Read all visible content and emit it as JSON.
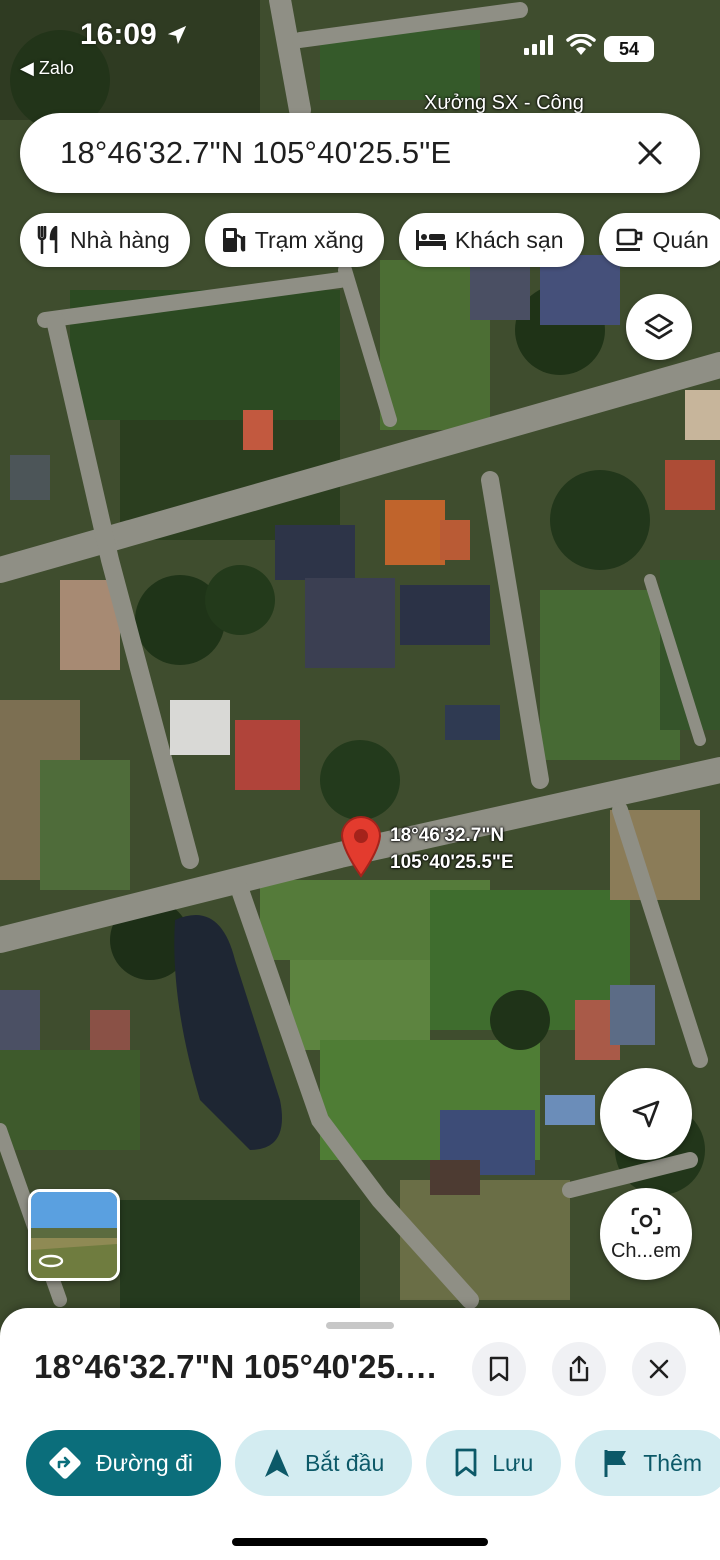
{
  "status_bar": {
    "time": "16:09",
    "back_app": "◀ Zalo",
    "battery": "54"
  },
  "map": {
    "place_label": "Xưởng SX - Công"
  },
  "search": {
    "query": "18°46'32.7\"N 105°40'25.5\"E"
  },
  "chips": [
    {
      "label": "Nhà hàng",
      "icon": "restaurant-icon"
    },
    {
      "label": "Trạm xăng",
      "icon": "gas-station-icon"
    },
    {
      "label": "Khách sạn",
      "icon": "hotel-icon"
    },
    {
      "label": "Quán",
      "icon": "cafe-icon"
    }
  ],
  "pin": {
    "lat": "18°46'32.7\"N",
    "lng": "105°40'25.5\"E"
  },
  "fabs": {
    "lens_label": "Ch...em"
  },
  "sheet": {
    "title": "18°46'32.7\"N 105°40'25.5\"E",
    "actions": [
      {
        "label": "Đường đi",
        "icon": "directions-icon"
      },
      {
        "label": "Bắt đầu",
        "icon": "navigation-arrow-icon"
      },
      {
        "label": "Lưu",
        "icon": "bookmark-icon"
      },
      {
        "label": "Thêm",
        "icon": "flag-icon"
      }
    ]
  },
  "colors": {
    "primary": "#0b6e7b",
    "tonal": "#d3ecf1",
    "pin": "#e33b2e"
  }
}
